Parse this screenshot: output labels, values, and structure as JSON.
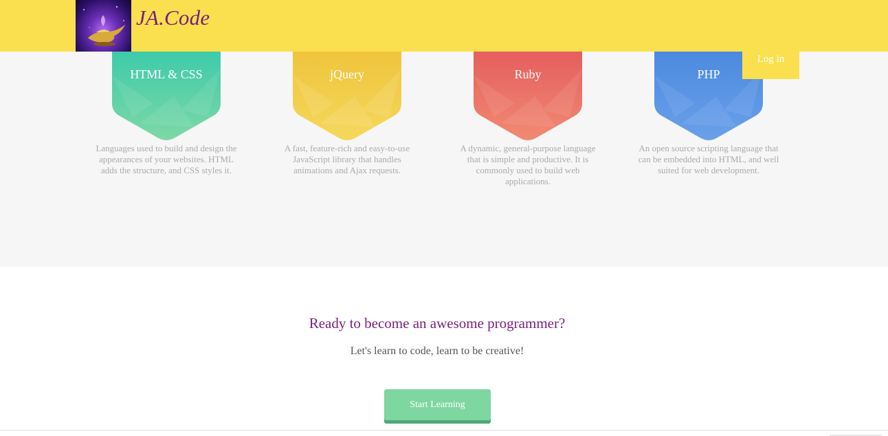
{
  "header": {
    "brand": "JA.Code",
    "login_label": "Log in",
    "logo_icon": "magic-lamp-icon",
    "background_color": "#fae04e"
  },
  "languages": [
    {
      "title": "HTML & CSS",
      "description": "Languages used to build and design the appearances of your websites. HTML adds the structure, and CSS styles it.",
      "color": "#2ec4a6"
    },
    {
      "title": "jQuery",
      "description": "A fast, feature-rich and easy-to-use JavaScript library that handles animations and Ajax requests.",
      "color": "#f0c93e"
    },
    {
      "title": "Ruby",
      "description": "A dynamic, general-purpose language that is simple and productive. It is commonly used to build web applications.",
      "color": "#e8656a"
    },
    {
      "title": "PHP",
      "description": "An open source scripting language that can be embedded into HTML, and well suited for web development.",
      "color": "#4d8be0"
    }
  ],
  "cta": {
    "title": "Ready to become an awesome programmer?",
    "subtitle": "Let's learn to code, learn to be creative!",
    "button_label": "Start Learning",
    "button_color": "#7ed6a0"
  }
}
